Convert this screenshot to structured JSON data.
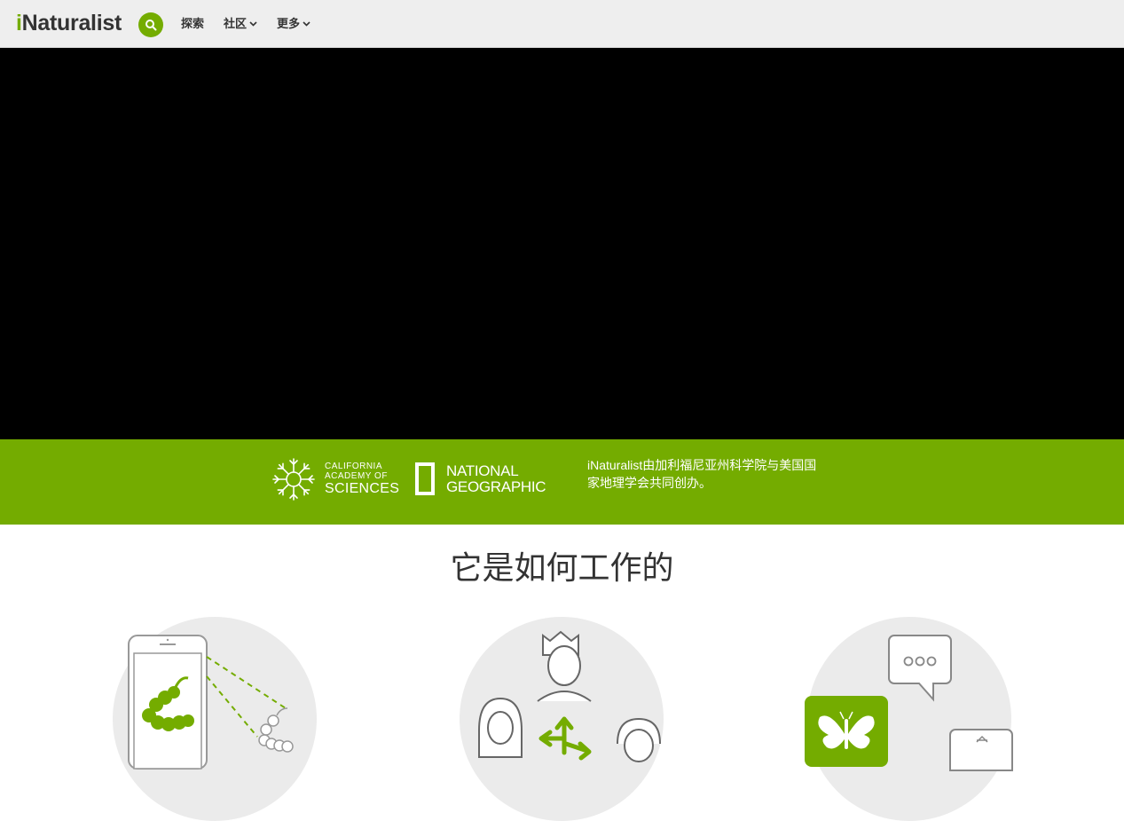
{
  "header": {
    "logo_prefix": "i",
    "logo_rest": "Naturalist",
    "nav": [
      {
        "label": "探索"
      },
      {
        "label": "社区"
      },
      {
        "label": "更多"
      }
    ]
  },
  "partners": {
    "cas_line1": "CALIFORNIA",
    "cas_line2": "ACADEMY OF",
    "cas_line3": "SCIENCES",
    "ng_line1": "NATIONAL",
    "ng_line2": "GEOGRAPHIC",
    "description": "iNaturalist由加利福尼亚州科学院与美国国家地理学会共同创办。"
  },
  "how_it_works": {
    "title": "它是如何工作的",
    "steps": [
      {
        "icon": "phone-caterpillar-icon"
      },
      {
        "icon": "community-arrows-icon"
      },
      {
        "icon": "butterfly-chat-icon"
      }
    ]
  },
  "colors": {
    "brand_green": "#74ac00",
    "header_bg": "#eeeeee",
    "video_bg": "#000000"
  }
}
